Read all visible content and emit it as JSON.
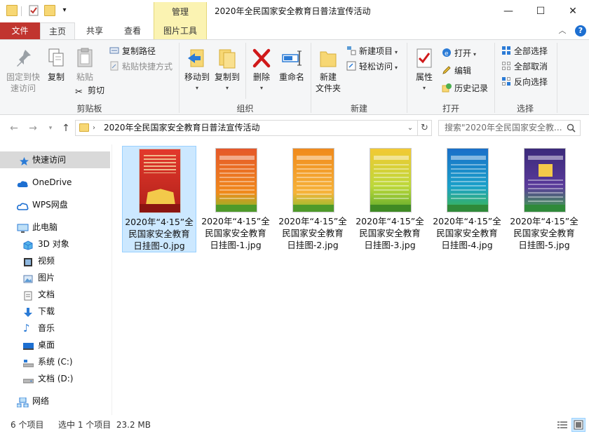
{
  "window": {
    "title": "2020年全民国家安全教育日普法宣传活动",
    "contextual_group": "管理",
    "minimize": "—",
    "maximize": "☐",
    "close": "✕"
  },
  "ribbon_tabs": [
    "文件",
    "主页",
    "共享",
    "查看",
    "图片工具"
  ],
  "ribbon": {
    "clipboard": {
      "label": "剪贴板",
      "pin": "固定到快速访问",
      "pin_line1": "固定到快",
      "pin_line2": "速访问",
      "copy": "复制",
      "paste": "粘贴",
      "copy_path": "复制路径",
      "paste_shortcut": "粘贴快捷方式",
      "cut": "剪切"
    },
    "organize": {
      "label": "组织",
      "move_to": "移动到",
      "copy_to": "复制到",
      "delete": "删除",
      "rename": "重命名"
    },
    "new": {
      "label": "新建",
      "new_folder_line1": "新建",
      "new_folder_line2": "文件夹",
      "new_item": "新建项目",
      "easy_access": "轻松访问"
    },
    "open": {
      "label": "打开",
      "properties": "属性",
      "open": "打开",
      "edit": "编辑",
      "history": "历史记录"
    },
    "select": {
      "label": "选择",
      "select_all": "全部选择",
      "select_none": "全部取消",
      "invert": "反向选择"
    }
  },
  "address": {
    "path": "2020年全民国家安全教育日普法宣传活动",
    "search_placeholder": "搜索\"2020年全民国家安全教..."
  },
  "sidebar": {
    "items": [
      {
        "label": "快速访问",
        "icon": "star-icon",
        "selected": true
      },
      {
        "label": "OneDrive",
        "icon": "cloud-icon"
      },
      {
        "label": "WPS网盘",
        "icon": "wps-cloud-icon"
      },
      {
        "label": "此电脑",
        "icon": "computer-icon"
      },
      {
        "label": "3D 对象",
        "icon": "cube-icon"
      },
      {
        "label": "视频",
        "icon": "video-icon"
      },
      {
        "label": "图片",
        "icon": "picture-icon"
      },
      {
        "label": "文档",
        "icon": "document-icon"
      },
      {
        "label": "下载",
        "icon": "download-icon"
      },
      {
        "label": "音乐",
        "icon": "music-icon"
      },
      {
        "label": "桌面",
        "icon": "desktop-icon"
      },
      {
        "label": "系统 (C:)",
        "icon": "drive-c-icon"
      },
      {
        "label": "文档 (D:)",
        "icon": "drive-d-icon"
      },
      {
        "label": "网络",
        "icon": "network-icon"
      }
    ]
  },
  "files": [
    {
      "line1": "2020年“4·15”全",
      "line2": "民国家安全教育",
      "line3": "日挂图-0.jpg",
      "theme": "#c72c22",
      "selected": true
    },
    {
      "line1": "2020年“4·15”全",
      "line2": "民国家安全教育",
      "line3": "日挂图-1.jpg",
      "theme": "#e5582a"
    },
    {
      "line1": "2020年“4·15”全",
      "line2": "民国家安全教育",
      "line3": "日挂图-2.jpg",
      "theme": "#f08a1c"
    },
    {
      "line1": "2020年“4·15”全",
      "line2": "民国家安全教育",
      "line3": "日挂图-3.jpg",
      "theme": "#7fbf2a"
    },
    {
      "line1": "2020年“4·15”全",
      "line2": "民国家安全教育",
      "line3": "日挂图-4.jpg",
      "theme": "#1aa0c9"
    },
    {
      "line1": "2020年“4·15”全",
      "line2": "民国家安全教育",
      "line3": "日挂图-5.jpg",
      "theme": "#5a3a9a"
    }
  ],
  "status": {
    "count": "6 个项目",
    "selection": "选中 1 个项目  23.2 MB"
  },
  "colors": {
    "file_tab": "#c1352f",
    "contextual_tab": "#fbf3b2",
    "selection": "#cce8ff"
  }
}
